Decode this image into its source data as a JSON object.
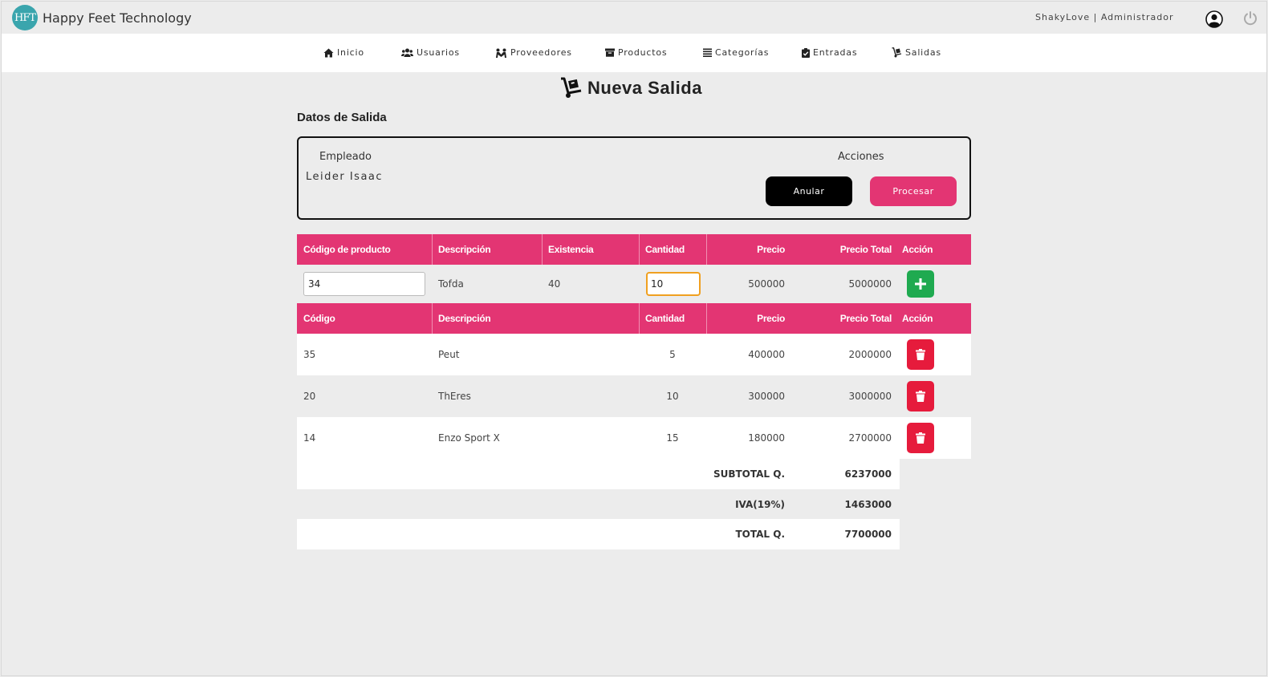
{
  "brand": {
    "logo_text": "HFT",
    "name": "Happy Feet Technology"
  },
  "user": {
    "label": "ShakyLove | Administrador"
  },
  "nav": [
    {
      "label": "Inicio",
      "icon": "home-icon"
    },
    {
      "label": "Usuarios",
      "icon": "users-icon"
    },
    {
      "label": "Proveedores",
      "icon": "suppliers-icon"
    },
    {
      "label": "Productos",
      "icon": "box-icon"
    },
    {
      "label": "Categorías",
      "icon": "list-icon"
    },
    {
      "label": "Entradas",
      "icon": "clipboard-check-icon"
    },
    {
      "label": "Salidas",
      "icon": "dolly-icon"
    }
  ],
  "page": {
    "title": "Nueva Salida",
    "section": "Datos de Salida"
  },
  "form": {
    "employee_label": "Empleado",
    "employee_value": "Leider Isaac",
    "actions_label": "Acciones",
    "cancel_label": "Anular",
    "process_label": "Procesar"
  },
  "entry": {
    "headers": [
      "Código de producto",
      "Descripción",
      "Existencia",
      "Cantidad",
      "Precio",
      "Precio Total",
      "Acción"
    ],
    "code_value": "34",
    "description": "Tofda",
    "stock": "40",
    "quantity_value": "10",
    "price": "500000",
    "total": "5000000"
  },
  "detail": {
    "headers": [
      "Código",
      "Descripción",
      "Cantidad",
      "Precio",
      "Precio Total",
      "Acción"
    ],
    "rows": [
      {
        "code": "35",
        "description": "Peut",
        "quantity": "5",
        "price": "400000",
        "total": "2000000"
      },
      {
        "code": "20",
        "description": "ThEres",
        "quantity": "10",
        "price": "300000",
        "total": "3000000"
      },
      {
        "code": "14",
        "description": "Enzo Sport X",
        "quantity": "15",
        "price": "180000",
        "total": "2700000"
      }
    ]
  },
  "totals": {
    "subtotal_label": "SUBTOTAL Q.",
    "subtotal": "6237000",
    "iva_label": "IVA(19%)",
    "iva": "1463000",
    "total_label": "TOTAL Q.",
    "total": "7700000"
  },
  "colors": {
    "accent": "#e33573",
    "add": "#1faa50",
    "delete": "#e61b3c",
    "logo": "#3aa5ad"
  }
}
